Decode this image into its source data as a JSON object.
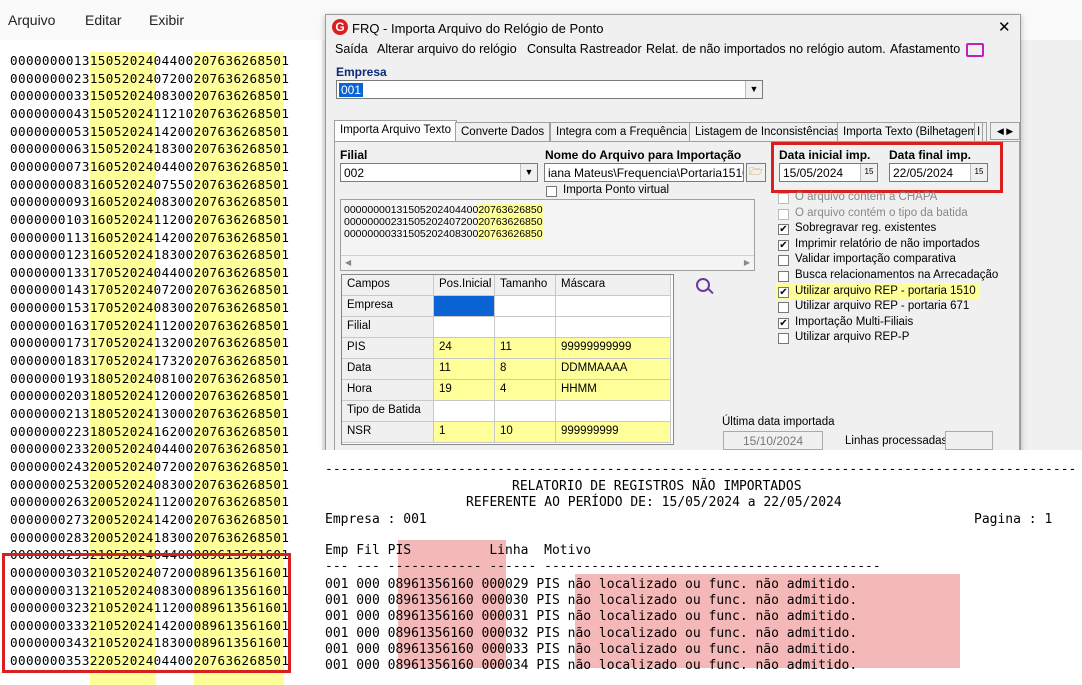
{
  "notepad": {
    "menu": [
      "Arquivo",
      "Editar",
      "Exibir"
    ],
    "lines": [
      "00000000131505202404400207636268501",
      "00000000231505202407200207636268501",
      "00000000331505202408300207636268501",
      "00000000431505202411210207636268501",
      "00000000531505202414200207636268501",
      "00000000631505202418300207636268501",
      "00000000731605202404400207636268501",
      "00000000831605202407550207636268501",
      "00000000931605202408300207636268501",
      "00000001031605202411200207636268501",
      "00000001131605202414200207636268501",
      "00000001231605202418300207636268501",
      "00000001331705202404400207636268501",
      "00000001431705202407200207636268501",
      "00000001531705202408300207636268501",
      "00000001631705202411200207636268501",
      "00000001731705202413200207636268501",
      "00000001831705202417320207636268501",
      "00000001931805202408100207636268501",
      "00000002031805202412000207636268501",
      "00000002131805202413000207636268501",
      "00000002231805202416200207636268501",
      "00000002332005202404400207636268501",
      "00000002432005202407200207636268501",
      "00000002532005202408300207636268501",
      "00000002632005202411200207636268501",
      "00000002732005202414200207636268501",
      "00000002832005202418300207636268501",
      "00000002932105202404400089613561601",
      "00000003032105202407200089613561601",
      "00000003132105202408300089613561601",
      "00000003232105202411200089613561601",
      "00000003332105202414200089613561601",
      "00000003432105202418300089613561601",
      "00000003532205202404400207636268501"
    ]
  },
  "dialog": {
    "title": "FRQ - Importa Arquivo do Relógio de Ponto",
    "close": "✕",
    "menu": [
      "Saída",
      "Alterar arquivo do relógio",
      "Consulta Rastreador",
      "Relat. de não importados no relógio autom.",
      "Afastamento"
    ],
    "empresa_label": "Empresa",
    "empresa_value": "001",
    "tabs": [
      "Importa Arquivo Texto",
      "Converte Dados",
      "Integra com a Frequência",
      "Listagem de Inconsistências",
      "Importa Texto (Bilhetagem)",
      "I"
    ],
    "filial_label": "Filial",
    "filial_value": "002",
    "arquivo_label": "Nome do Arquivo para Importação",
    "arquivo_value": "iana Mateus\\Frequencia\\Portaria1510.txt",
    "ponto_virtual_label": "Importa Ponto virtual",
    "data_inicial_label": "Data inicial imp.",
    "data_inicial_value": "15/05/2024",
    "data_final_label": "Data final imp.",
    "data_final_value": "22/05/2024",
    "preview": [
      "000000001315052024044002076362685​0",
      "000000002315052024072002076362685​0",
      "000000003315052024083002076362685​0"
    ],
    "preview_a": [
      "00000000131505202404400",
      "00000000231505202407200",
      "00000000331505202408300"
    ],
    "preview_b": [
      "20763626850",
      "20763626850",
      "20763626850"
    ],
    "options": [
      {
        "label": "O arquivo contém a CHAPA",
        "checked": false,
        "disabled": true
      },
      {
        "label": "O arquivo contém o tipo da batida",
        "checked": false,
        "disabled": true
      },
      {
        "label": "Sobregravar reg. existentes",
        "checked": true,
        "disabled": false
      },
      {
        "label": "Imprimir relatório de não importados",
        "checked": true,
        "disabled": false
      },
      {
        "label": "Validar importação comparativa",
        "checked": false,
        "disabled": false
      },
      {
        "label": "Busca relacionamentos na Arrecadação",
        "checked": false,
        "disabled": false
      },
      {
        "label": "Utilizar arquivo REP - portaria 1510",
        "checked": true,
        "disabled": false
      },
      {
        "label": "Utilizar arquivo REP - portaria 671",
        "checked": false,
        "disabled": false
      },
      {
        "label": "Importação Multi-Filiais",
        "checked": true,
        "disabled": false
      },
      {
        "label": "Utilizar arquivo REP-P",
        "checked": false,
        "disabled": false
      }
    ],
    "grid_headers": [
      "Campos",
      "Pos.Inicial",
      "Tamanho",
      "Máscara"
    ],
    "grid_rows": [
      {
        "campo": "Empresa",
        "pos": "",
        "tam": "",
        "masc": ""
      },
      {
        "campo": "Filial",
        "pos": "",
        "tam": "",
        "masc": ""
      },
      {
        "campo": "PIS",
        "pos": "24",
        "tam": "11",
        "masc": "99999999999"
      },
      {
        "campo": "Data",
        "pos": "11",
        "tam": "8",
        "masc": "DDMMAAAA"
      },
      {
        "campo": "Hora",
        "pos": "19",
        "tam": "4",
        "masc": "HHMM"
      },
      {
        "campo": "Tipo de Batida",
        "pos": "",
        "tam": "",
        "masc": ""
      },
      {
        "campo": "NSR",
        "pos": "1",
        "tam": "10",
        "masc": "999999999"
      }
    ],
    "ultima_label": "Última data importada",
    "ultima_value": "15/10/2024",
    "linhas_label": "Linhas processadas",
    "linhas_value": ""
  },
  "report": {
    "dashes": "------------------------------------------------------------------------------------------------",
    "title1": "RELATORIO DE REGISTROS NÃO IMPORTADOS",
    "title2": "REFERENTE AO PERÍODO DE: 15/05/2024 a 22/05/2024",
    "empresa": "Empresa : 001",
    "pagina": "Pagina : 1",
    "headers": "Emp Fil PIS          Linha  Motivo",
    "underline": "--- --- ------------ ------ -------------------------------------------",
    "rows": [
      "001 000 08961356160 000029 PIS não localizado ou func. não admitido.",
      "001 000 08961356160 000030 PIS não localizado ou func. não admitido.",
      "001 000 08961356160 000031 PIS não localizado ou func. não admitido.",
      "001 000 08961356160 000032 PIS não localizado ou func. não admitido.",
      "001 000 08961356160 000033 PIS não localizado ou func. não admitido.",
      "001 000 08961356160 000034 PIS não localizado ou func. não admitido."
    ]
  },
  "colors": {
    "highlight_yellow": "#ffff99",
    "highlight_red": "#d92020",
    "highlight_pink": "#f4b8b8",
    "selection_blue": "#0a64d6"
  }
}
